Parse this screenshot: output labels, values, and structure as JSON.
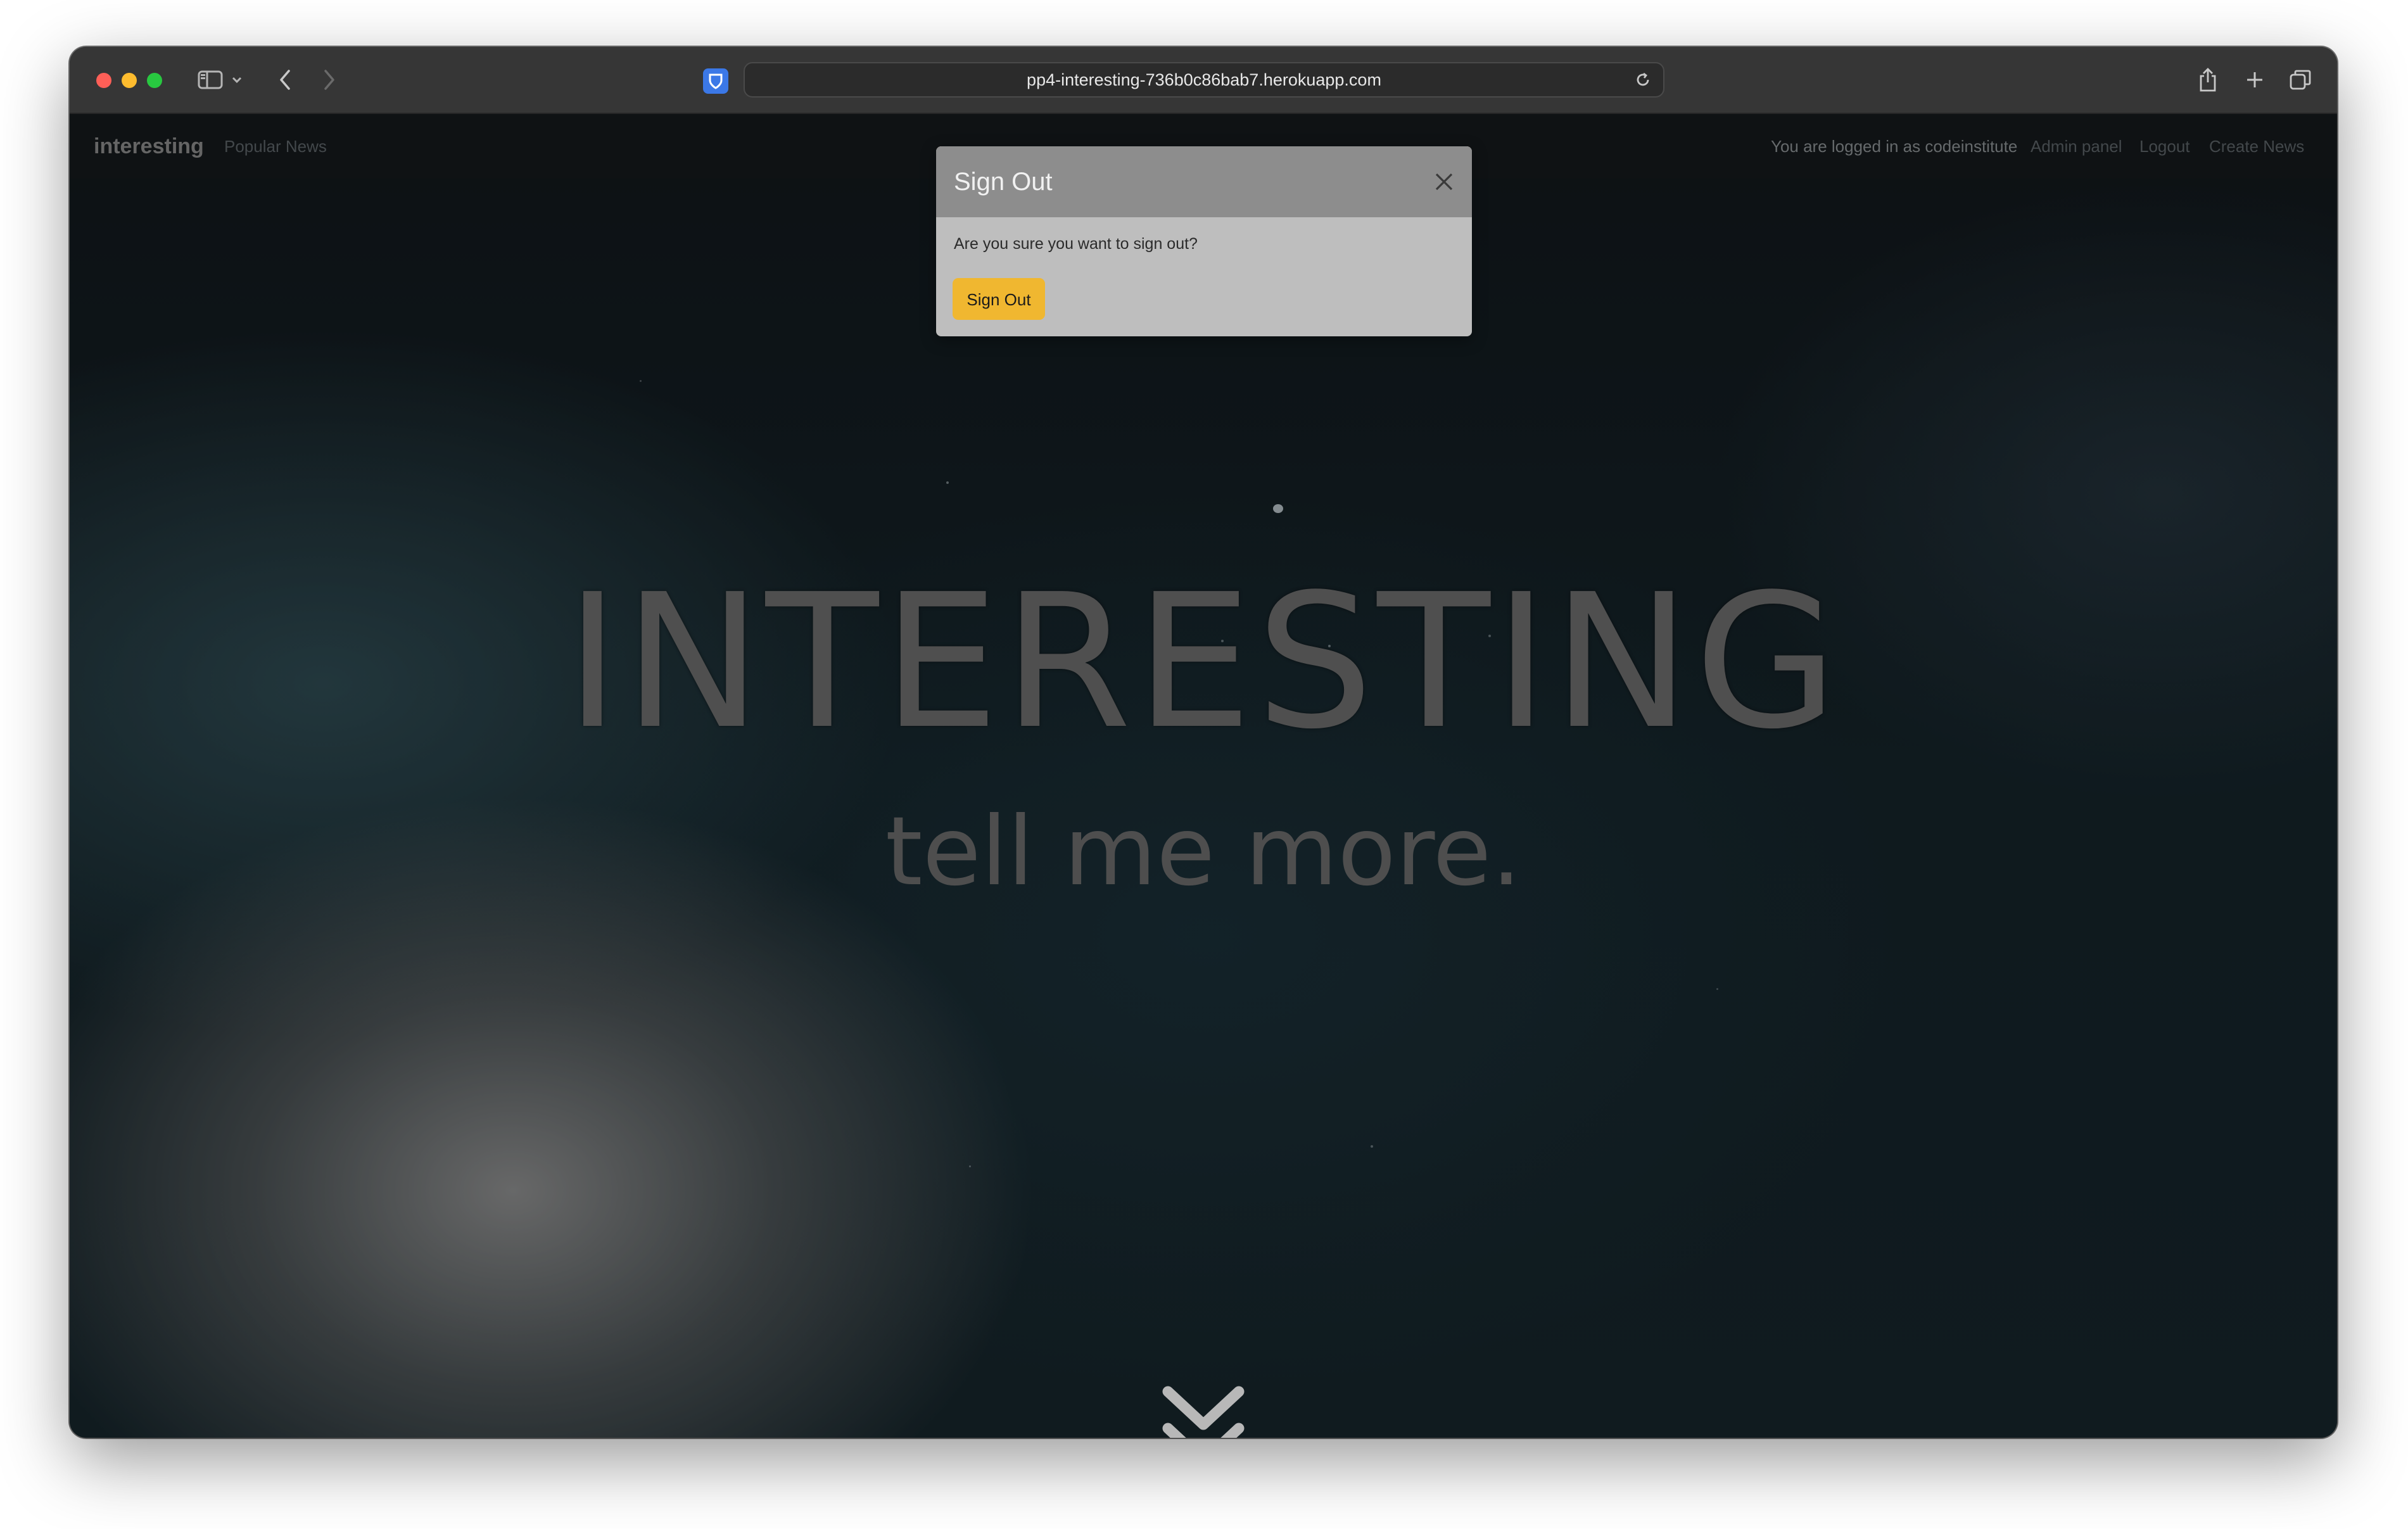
{
  "browser": {
    "url": "pp4-interesting-736b0c86bab7.herokuapp.com"
  },
  "navbar": {
    "brand": "interesting",
    "popular": "Popular News",
    "status": "You are logged in as codeinstitute",
    "admin": "Admin panel",
    "logout": "Logout",
    "create": "Create News"
  },
  "hero": {
    "title": "INTERESTING",
    "subtitle": "tell me more."
  },
  "modal": {
    "title": "Sign Out",
    "body": "Are you sure you want to sign out?",
    "button": "Sign Out"
  },
  "colors": {
    "signout_button": "#f0b730",
    "modal_header": "#8d8d8d",
    "modal_body": "#bebebe"
  }
}
